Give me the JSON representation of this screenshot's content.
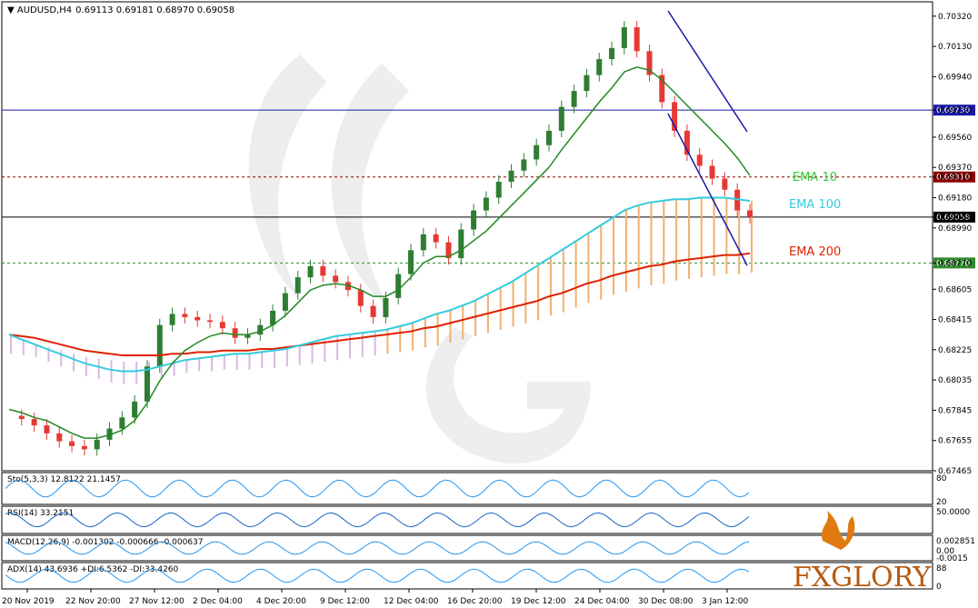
{
  "chart_data": {
    "type": "line",
    "instrument": "AUDUSD,H4",
    "title_values": "0.69113 0.69181 0.68970 0.69058",
    "y_range": [
      0.67465,
      0.7041
    ],
    "y_ticks": [
      "0.70320",
      "0.70130",
      "0.69940",
      "0.69730",
      "0.69560",
      "0.69370",
      "0.69310",
      "0.69180",
      "0.69058",
      "0.68990",
      "0.68770",
      "0.68605",
      "0.68415",
      "0.68225",
      "0.68035",
      "0.67845",
      "0.67655",
      "0.67465"
    ],
    "x_ticks": [
      "20 Nov 2019",
      "22 Nov 20:00",
      "27 Nov 12:00",
      "2 Dec 04:00",
      "4 Dec 20:00",
      "9 Dec 12:00",
      "12 Dec 04:00",
      "16 Dec 20:00",
      "19 Dec 12:00",
      "24 Dec 04:00",
      "30 Dec 08:00",
      "3 Jan 12:00"
    ],
    "levels": [
      {
        "value": 0.6973,
        "label": "0.69730",
        "color": "#1a1aa8",
        "style": "solid"
      },
      {
        "value": 0.6931,
        "label": "0.69310",
        "color": "#8b0000",
        "style": "dashed"
      },
      {
        "value": 0.69058,
        "label": "0.69058",
        "color": "#000000",
        "style": "solid"
      },
      {
        "value": 0.6877,
        "label": "0.68770",
        "color": "#2e8b2e",
        "style": "dashed"
      }
    ],
    "ema_labels": [
      {
        "text": "EMA 10",
        "color": "#33cc33"
      },
      {
        "text": "EMA 100",
        "color": "#33ccdd"
      },
      {
        "text": "EMA 200",
        "color": "#dd2200"
      }
    ],
    "close_series": [
      0.6781,
      0.6779,
      0.6775,
      0.677,
      0.6765,
      0.6762,
      0.676,
      0.6766,
      0.6773,
      0.678,
      0.679,
      0.6812,
      0.6838,
      0.6845,
      0.6843,
      0.6841,
      0.684,
      0.6836,
      0.683,
      0.6832,
      0.6838,
      0.6847,
      0.6858,
      0.6868,
      0.6875,
      0.6869,
      0.6865,
      0.686,
      0.685,
      0.6843,
      0.6855,
      0.687,
      0.6885,
      0.6895,
      0.689,
      0.688,
      0.6898,
      0.691,
      0.6918,
      0.6928,
      0.6935,
      0.6942,
      0.6951,
      0.696,
      0.6975,
      0.6985,
      0.6995,
      0.7005,
      0.7012,
      0.7025,
      0.701,
      0.6995,
      0.6978,
      0.696,
      0.6945,
      0.6938,
      0.693,
      0.6923,
      0.691,
      0.69058
    ],
    "ema10": [
      0.6785,
      0.6783,
      0.678,
      0.6778,
      0.6774,
      0.677,
      0.6767,
      0.6767,
      0.6769,
      0.6772,
      0.6778,
      0.6789,
      0.6803,
      0.6814,
      0.6822,
      0.6827,
      0.6831,
      0.6833,
      0.6832,
      0.6832,
      0.6834,
      0.6838,
      0.6844,
      0.6852,
      0.686,
      0.6863,
      0.6864,
      0.6863,
      0.686,
      0.6856,
      0.6856,
      0.686,
      0.6868,
      0.6877,
      0.6881,
      0.6881,
      0.6885,
      0.6891,
      0.6897,
      0.6905,
      0.6913,
      0.6921,
      0.6929,
      0.6937,
      0.6948,
      0.6958,
      0.6968,
      0.6978,
      0.6987,
      0.6997,
      0.7,
      0.6998,
      0.6992,
      0.6984,
      0.6976,
      0.6968,
      0.696,
      0.6952,
      0.6943,
      0.6932
    ],
    "ema100": [
      0.6832,
      0.6829,
      0.6826,
      0.6823,
      0.682,
      0.6817,
      0.6814,
      0.6812,
      0.681,
      0.6809,
      0.6809,
      0.681,
      0.6812,
      0.6814,
      0.6816,
      0.6817,
      0.6818,
      0.6819,
      0.682,
      0.682,
      0.6821,
      0.6822,
      0.6823,
      0.6825,
      0.6827,
      0.6829,
      0.6831,
      0.6832,
      0.6833,
      0.6834,
      0.6835,
      0.6837,
      0.6839,
      0.6842,
      0.6845,
      0.6847,
      0.685,
      0.6853,
      0.6857,
      0.6861,
      0.6865,
      0.687,
      0.6875,
      0.688,
      0.6885,
      0.689,
      0.6895,
      0.69,
      0.6905,
      0.691,
      0.6913,
      0.6915,
      0.6916,
      0.6917,
      0.6917,
      0.6918,
      0.6918,
      0.6918,
      0.6917,
      0.6916
    ],
    "ema200": [
      0.6832,
      0.6831,
      0.683,
      0.6828,
      0.6826,
      0.6824,
      0.6822,
      0.6821,
      0.682,
      0.6819,
      0.6819,
      0.6819,
      0.6819,
      0.682,
      0.682,
      0.6821,
      0.6821,
      0.6822,
      0.6822,
      0.6822,
      0.6823,
      0.6823,
      0.6824,
      0.6825,
      0.6826,
      0.6827,
      0.6828,
      0.6829,
      0.683,
      0.6831,
      0.6832,
      0.6833,
      0.6834,
      0.6836,
      0.6837,
      0.6839,
      0.6841,
      0.6843,
      0.6845,
      0.6847,
      0.6849,
      0.6851,
      0.6853,
      0.6856,
      0.6858,
      0.6861,
      0.6864,
      0.6866,
      0.6869,
      0.6871,
      0.6873,
      0.6875,
      0.6876,
      0.6878,
      0.6879,
      0.688,
      0.6881,
      0.6882,
      0.6882,
      0.6883
    ],
    "indicators": [
      {
        "label": "Sto(5,3,3) 12.8122 21.1457",
        "right_labels": [
          "80",
          "20"
        ]
      },
      {
        "label": "RSI(14) 33.2151",
        "right_labels": [
          "50.0000"
        ]
      },
      {
        "label": "MACD(12,26,9) -0.001302 -0.000666 -0.000637",
        "right_labels": [
          "0.002851",
          "0.00",
          "-0.0015"
        ]
      },
      {
        "label": "ADX(14) 43.6936 +DI:6.5362 -DI:33.4260",
        "right_labels": [
          "88",
          "0"
        ]
      }
    ],
    "brand": "FXGLORY"
  }
}
